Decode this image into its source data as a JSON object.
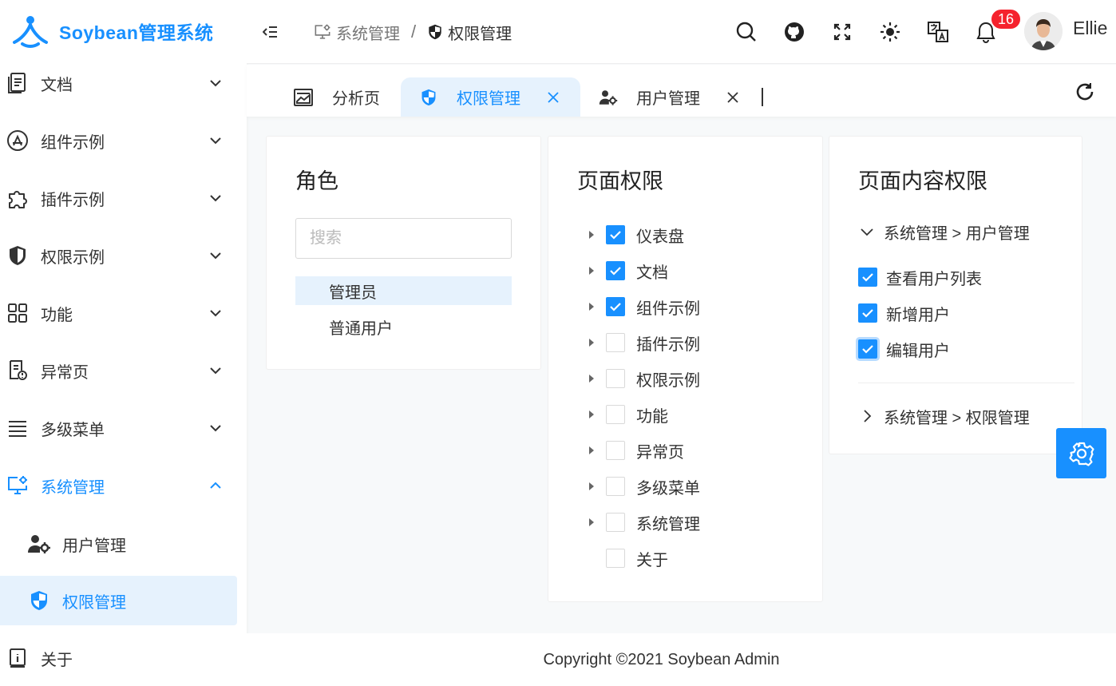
{
  "app": {
    "logo_text": "Soybean管理系统"
  },
  "sidebar": {
    "items": [
      {
        "label": "文档",
        "icon": "document-icon"
      },
      {
        "label": "组件示例",
        "icon": "app-store-icon"
      },
      {
        "label": "插件示例",
        "icon": "puzzle-icon"
      },
      {
        "label": "权限示例",
        "icon": "shield-icon"
      },
      {
        "label": "功能",
        "icon": "grid-icon"
      },
      {
        "label": "异常页",
        "icon": "error-page-icon"
      },
      {
        "label": "多级菜单",
        "icon": "menu-icon"
      },
      {
        "label": "系统管理",
        "icon": "monitor-gear-icon"
      }
    ],
    "sub_items": [
      {
        "label": "用户管理",
        "icon": "user-gear-icon"
      },
      {
        "label": "权限管理",
        "icon": "shield-half-icon"
      }
    ],
    "about": {
      "label": "关于",
      "icon": "info-icon"
    }
  },
  "header": {
    "breadcrumb": [
      {
        "label": "系统管理",
        "icon": "monitor-gear-icon"
      },
      {
        "label": "权限管理",
        "icon": "shield-half-icon"
      }
    ],
    "breadcrumb_separator": "/",
    "notification_count": "16",
    "username": "Ellie"
  },
  "tabs": [
    {
      "label": "分析页",
      "icon": "chart-area-icon",
      "closable": false
    },
    {
      "label": "权限管理",
      "icon": "shield-half-icon",
      "closable": true,
      "active": true
    },
    {
      "label": "用户管理",
      "icon": "user-gear-icon",
      "closable": true
    }
  ],
  "tab_close_glyph": "X",
  "roles_card": {
    "title": "角色",
    "search_placeholder": "搜索",
    "roles": [
      {
        "label": "管理员",
        "selected": true
      },
      {
        "label": "普通用户",
        "selected": false
      }
    ]
  },
  "page_perm_card": {
    "title": "页面权限",
    "nodes": [
      {
        "label": "仪表盘",
        "checked": true,
        "expandable": true
      },
      {
        "label": "文档",
        "checked": true,
        "expandable": true
      },
      {
        "label": "组件示例",
        "checked": true,
        "expandable": true
      },
      {
        "label": "插件示例",
        "checked": false,
        "expandable": true
      },
      {
        "label": "权限示例",
        "checked": false,
        "expandable": true
      },
      {
        "label": "功能",
        "checked": false,
        "expandable": true
      },
      {
        "label": "异常页",
        "checked": false,
        "expandable": true
      },
      {
        "label": "多级菜单",
        "checked": false,
        "expandable": true
      },
      {
        "label": "系统管理",
        "checked": false,
        "expandable": true
      },
      {
        "label": "关于",
        "checked": false,
        "expandable": false
      }
    ]
  },
  "content_perm_card": {
    "title": "页面内容权限",
    "groups": [
      {
        "label": "系统管理 > 用户管理",
        "expanded": true,
        "items": [
          {
            "label": "查看用户列表",
            "checked": true
          },
          {
            "label": "新增用户",
            "checked": true
          },
          {
            "label": "编辑用户",
            "checked": true,
            "focused": true
          }
        ]
      },
      {
        "label": "系统管理 > 权限管理",
        "expanded": false,
        "items": []
      }
    ]
  },
  "footer": {
    "copyright": "Copyright ©2021 Soybean Admin"
  },
  "colors": {
    "primary": "#1890ff",
    "badge": "#f5222d",
    "active_bg": "#e6f2fd"
  }
}
